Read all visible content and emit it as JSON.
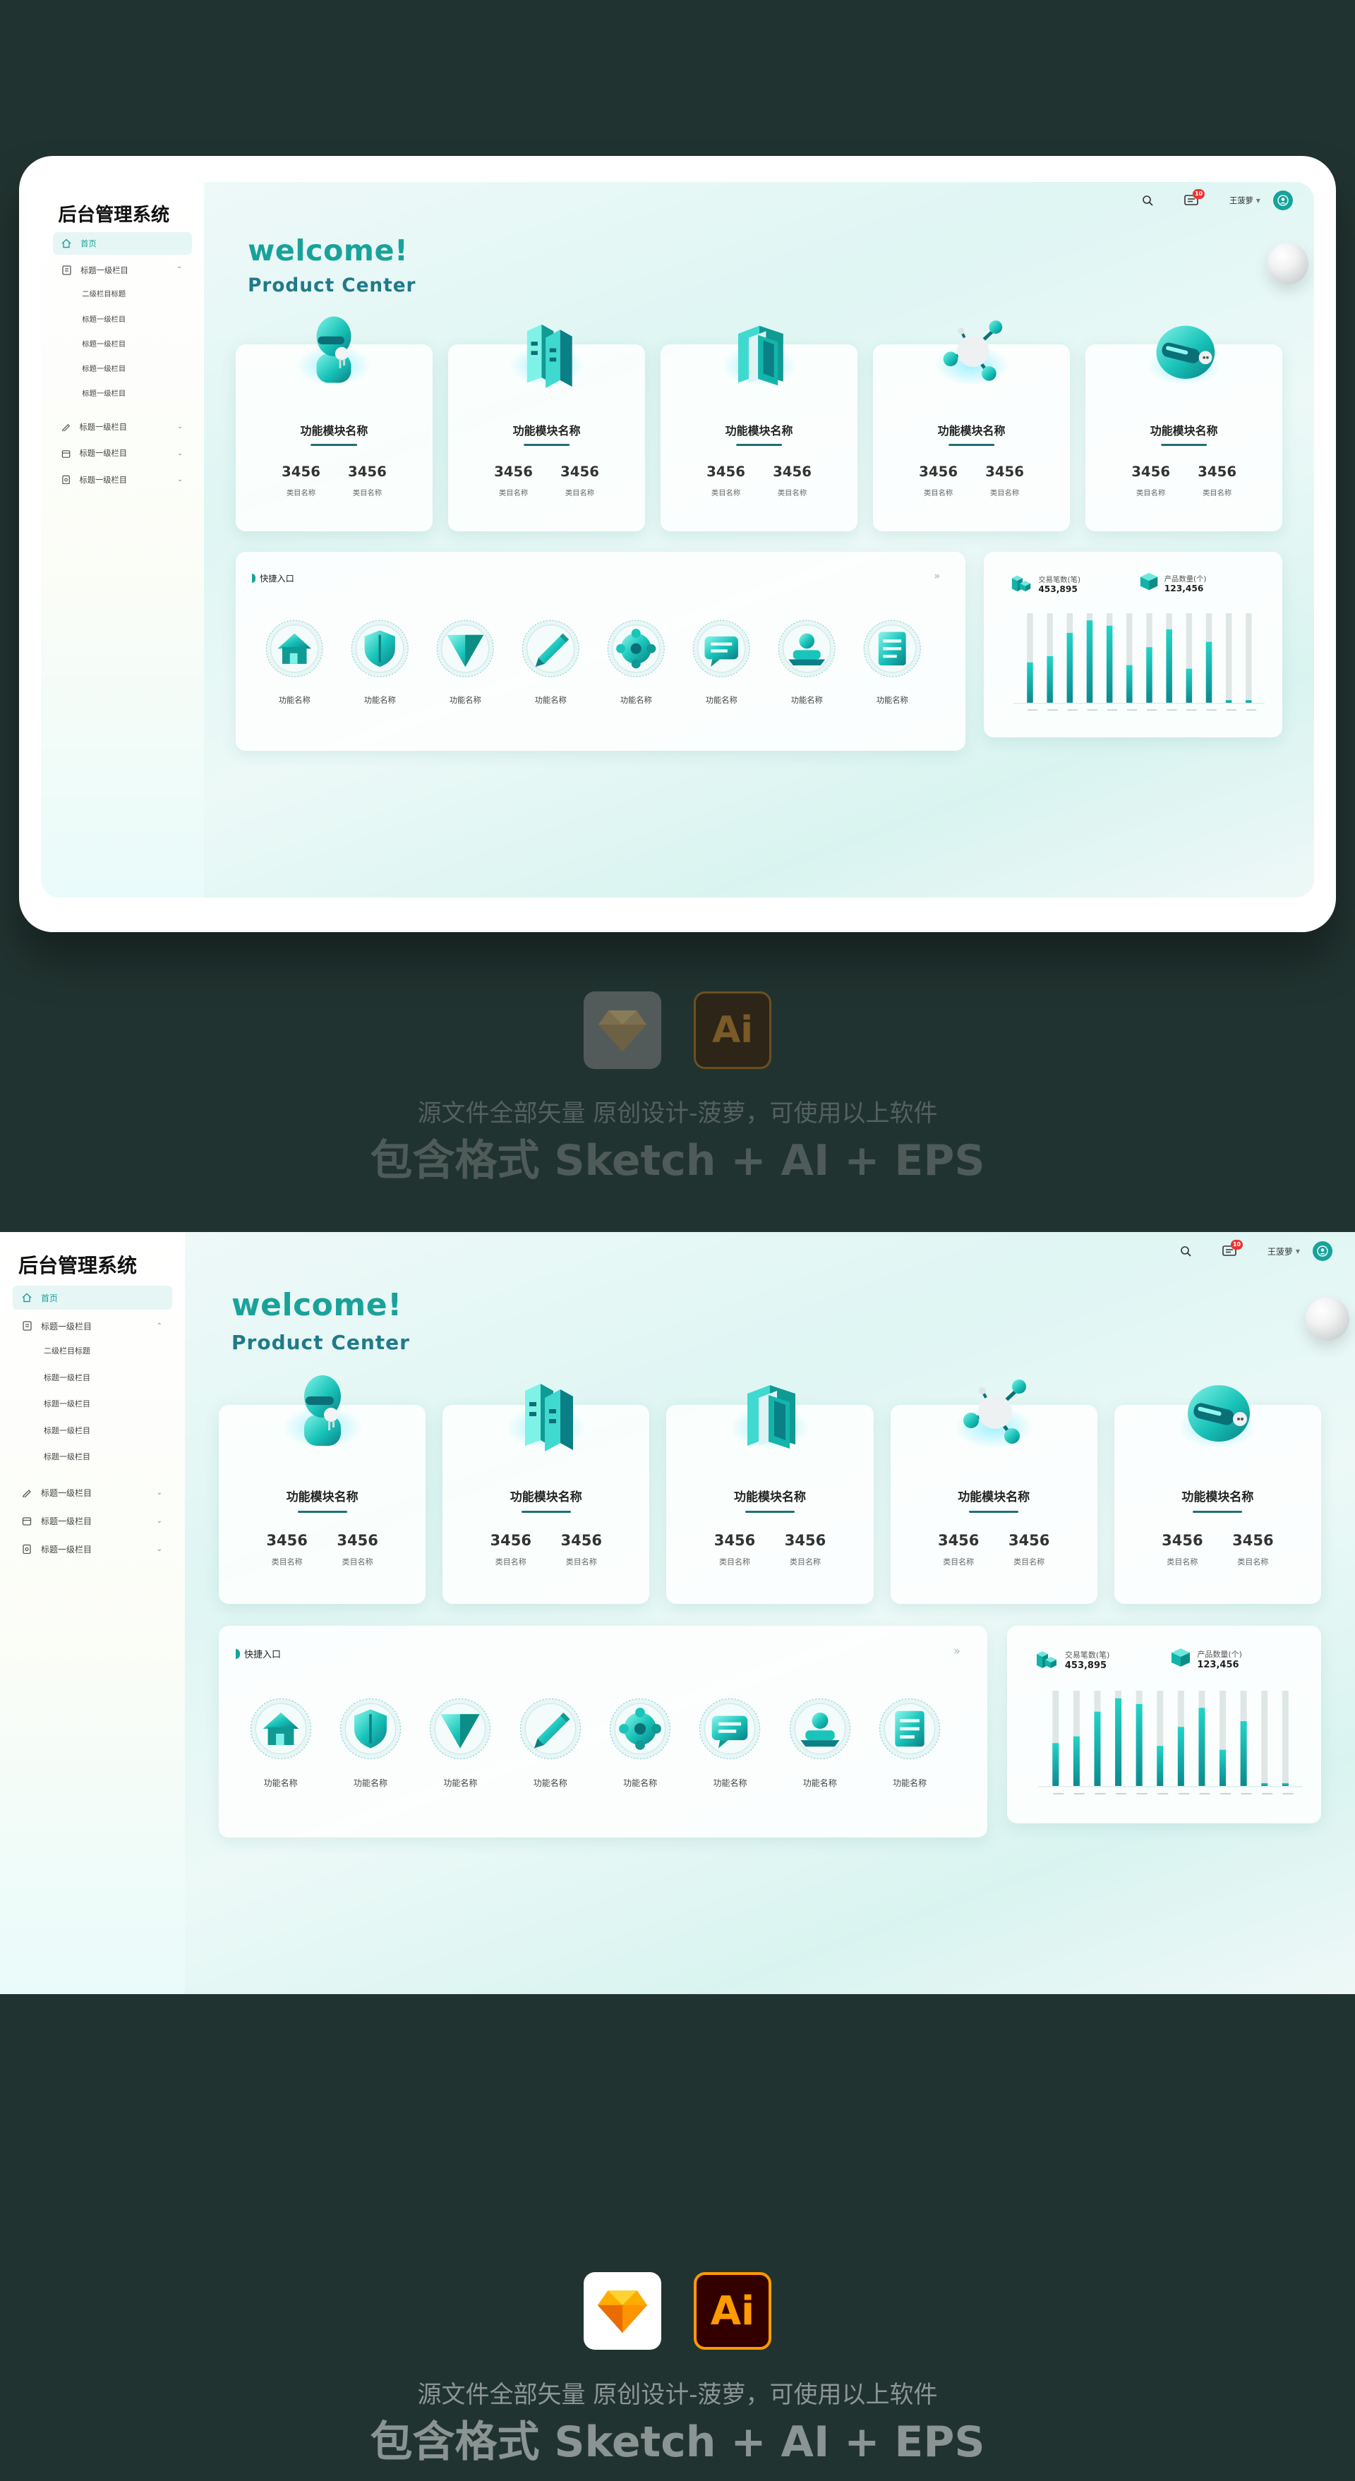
{
  "app": {
    "title": "后台管理系统",
    "welcome": "welcome!",
    "subtitle": "Product Center"
  },
  "sidebar": {
    "home": "首页",
    "group_open": "标题一级栏目",
    "sub_items": [
      "二级栏目标题",
      "标题一级栏目",
      "标题一级栏目",
      "标题一级栏目",
      "标题一级栏目"
    ],
    "groups_closed": [
      "标题一级栏目",
      "标题一级栏目",
      "标题一级栏目"
    ]
  },
  "topbar": {
    "message_count": "10",
    "user_name": "王菠萝"
  },
  "modules": [
    {
      "title": "功能模块名称",
      "icon": "robot-icon",
      "stats": [
        {
          "value": "3456",
          "label": "类目名称"
        },
        {
          "value": "3456",
          "label": "类目名称"
        }
      ]
    },
    {
      "title": "功能模块名称",
      "icon": "buildings-icon",
      "stats": [
        {
          "value": "3456",
          "label": "类目名称"
        },
        {
          "value": "3456",
          "label": "类目名称"
        }
      ]
    },
    {
      "title": "功能模块名称",
      "icon": "doors-icon",
      "stats": [
        {
          "value": "3456",
          "label": "类目名称"
        },
        {
          "value": "3456",
          "label": "类目名称"
        }
      ]
    },
    {
      "title": "功能模块名称",
      "icon": "molecule-icon",
      "stats": [
        {
          "value": "3456",
          "label": "类目名称"
        },
        {
          "value": "3456",
          "label": "类目名称"
        }
      ]
    },
    {
      "title": "功能模块名称",
      "icon": "helmet-icon",
      "stats": [
        {
          "value": "3456",
          "label": "类目名称"
        },
        {
          "value": "3456",
          "label": "类目名称"
        }
      ]
    }
  ],
  "quick": {
    "title": "快捷入口",
    "items": [
      {
        "label": "功能名称",
        "icon": "home-icon"
      },
      {
        "label": "功能名称",
        "icon": "shield-icon"
      },
      {
        "label": "功能名称",
        "icon": "triangle-icon"
      },
      {
        "label": "功能名称",
        "icon": "pencil-icon"
      },
      {
        "label": "功能名称",
        "icon": "gear-icon"
      },
      {
        "label": "功能名称",
        "icon": "chat-icon"
      },
      {
        "label": "功能名称",
        "icon": "user-icon"
      },
      {
        "label": "功能名称",
        "icon": "document-icon"
      }
    ]
  },
  "stats_panel": {
    "trade_label": "交易笔数(笔)",
    "trade_value": "453,895",
    "product_label": "产品数量(个)",
    "product_value": "123,456"
  },
  "chart_data": {
    "type": "bar",
    "categories": [
      "",
      "",
      "",
      "",
      "",
      "",
      "",
      "",
      "",
      "",
      "",
      ""
    ],
    "values": [
      45,
      52,
      78,
      92,
      86,
      42,
      62,
      82,
      38,
      68,
      3,
      3
    ],
    "ylim": [
      0,
      100
    ],
    "grid": false,
    "legend": "none"
  },
  "footer": {
    "line1": "源文件全部矢量 原创设计-菠萝，可使用以上软件",
    "line2": "包含格式 Sketch + AI + EPS",
    "sketch_logo": "sketch-logo",
    "ai_logo_text": "Ai"
  },
  "colors": {
    "background": "#213330",
    "accent": "#17a39c",
    "accent_dark": "#1f6f75",
    "footer_text_dim": "#5f6b69",
    "footer_text": "#8f9a98"
  }
}
